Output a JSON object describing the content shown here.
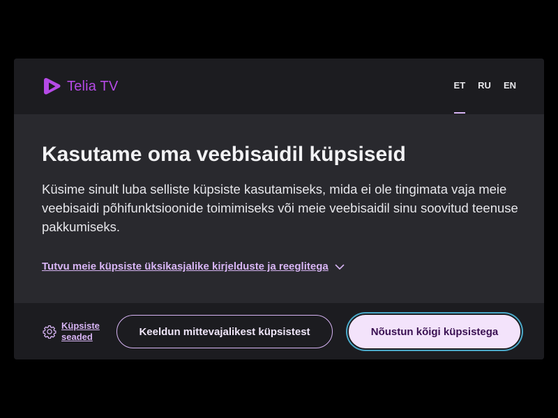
{
  "brand": {
    "name": "Telia TV",
    "color": "#b54ae6",
    "icon": "telia-play-logo-icon"
  },
  "languages": {
    "items": [
      {
        "code": "ET",
        "active": true
      },
      {
        "code": "RU",
        "active": false
      },
      {
        "code": "EN",
        "active": false
      }
    ]
  },
  "consent": {
    "title": "Kasutame oma veebisaidil küpsiseid",
    "body": "Küsime sinult luba selliste küpsiste kasutamiseks, mida ei ole tingimata vaja meie veebisaidi põhifunktsioonide toimimiseks või meie veebisaidil sinu soovitud teenuse pakkumiseks.",
    "details_link": "Tutvu meie küpsiste üksikasjalike kirjelduste ja reeglitega",
    "details_icon": "chevron-down-icon"
  },
  "footer": {
    "settings_label": "Küpsiste seaded",
    "settings_icon": "gear-icon",
    "decline_label": "Keeldun mittevajalikest küpsistest",
    "accept_label": "Nõustun kõigi küpsistega"
  },
  "colors": {
    "accent": "#d8b5f5",
    "background": "#1c1c20",
    "panel": "#29292e",
    "focus_ring": "#4aa9c9"
  }
}
